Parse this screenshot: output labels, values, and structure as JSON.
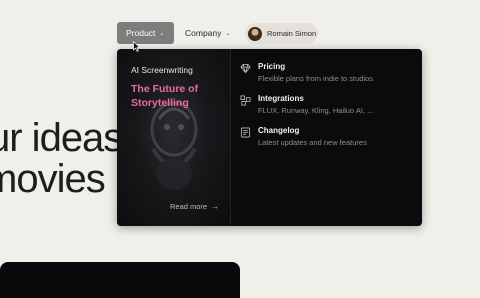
{
  "nav": {
    "product_label": "Product",
    "company_label": "Company",
    "user_name": "Romain Simon"
  },
  "hero": {
    "line1": "ur ideas",
    "line2": "movies"
  },
  "dropdown": {
    "feature": {
      "eyebrow": "AI Screenwriting",
      "title": "The Future of Storytelling",
      "link_label": "Read more",
      "title_color": "#e96aa7"
    },
    "items": [
      {
        "icon": "diamond-icon",
        "title": "Pricing",
        "description": "Flexible plans from indie to studios"
      },
      {
        "icon": "integrations-icon",
        "title": "Integrations",
        "description": "FLUX, Runway, Kling, Hailuo AI, ..."
      },
      {
        "icon": "changelog-icon",
        "title": "Changelog",
        "description": "Latest updates and new features"
      }
    ]
  },
  "colors": {
    "background": "#f1efea",
    "dropdown": "#0b0b0e",
    "active_nav": "#7d7d7d"
  }
}
